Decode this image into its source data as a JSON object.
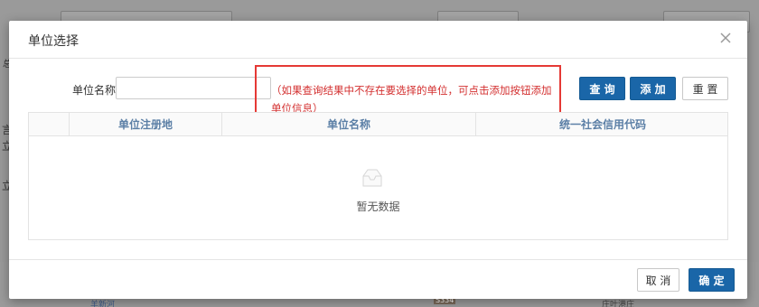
{
  "background": {
    "labels": [
      "总",
      "言",
      "立",
      "立"
    ],
    "map_badge": "S334",
    "map_labels": [
      "羊新河",
      "庄叶港庄"
    ]
  },
  "dialog": {
    "title": "单位选择",
    "close_icon": "close-icon",
    "search": {
      "label": "单位名称",
      "value": "",
      "placeholder": ""
    },
    "hint": "（如果查询结果中不存在要选择的单位，可点击添加按钮添加单位信息）",
    "buttons": {
      "query": "查 询",
      "add": "添 加",
      "reset": "重 置"
    },
    "table": {
      "columns": [
        "单位注册地",
        "单位名称",
        "统一社会信用代码"
      ],
      "rows": [],
      "empty_text": "暂无数据",
      "empty_icon": "empty-inbox-icon"
    },
    "footer": {
      "cancel": "取 消",
      "confirm": "确 定"
    }
  },
  "colors": {
    "primary": "#1a66a8",
    "hint": "#d32f2f",
    "highlight_border": "#e53935"
  }
}
